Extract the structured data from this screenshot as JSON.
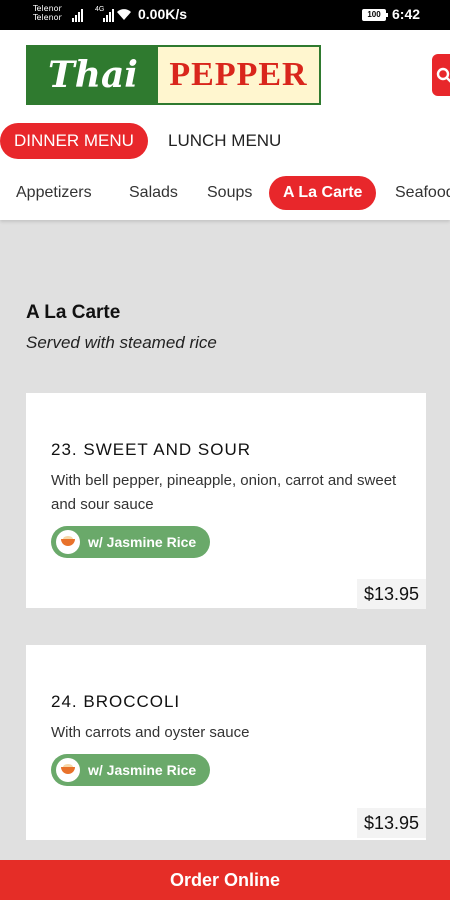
{
  "status_bar": {
    "carrier_1": "Telenor",
    "carrier_2": "Telenor",
    "network_type": "4G",
    "speed": "0.00K/s",
    "battery": "100",
    "time": "6:42"
  },
  "header": {
    "logo_thai": "Thai",
    "logo_pepper": "PEPPER",
    "search_icon": "search-icon",
    "menus": [
      {
        "label": "DINNER MENU",
        "active": true
      },
      {
        "label": "LUNCH MENU",
        "active": false
      }
    ],
    "categories": [
      {
        "label": "Appetizers",
        "active": false
      },
      {
        "label": "Salads",
        "active": false
      },
      {
        "label": "Soups",
        "active": false
      },
      {
        "label": "A La Carte",
        "active": true
      },
      {
        "label": "Seafood",
        "active": false
      }
    ]
  },
  "section": {
    "title": "A La Carte",
    "subtitle": "Served with steamed rice"
  },
  "items": [
    {
      "name": "23. SWEET AND SOUR",
      "description": "With bell pepper, pineapple, onion, carrot and sweet and sour sauce",
      "badge": "w/ Jasmine Rice",
      "badge_icon": "rice-bowl-icon",
      "price": "$13.95"
    },
    {
      "name": "24. BROCCOLI",
      "description": "With carrots and oyster sauce",
      "badge": "w/ Jasmine Rice",
      "badge_icon": "rice-bowl-icon",
      "price": "$13.95"
    }
  ],
  "order_button": "Order Online",
  "colors": {
    "accent": "#e8272b",
    "logo_green": "#2f7a2f",
    "badge_green": "#6aa96a"
  }
}
